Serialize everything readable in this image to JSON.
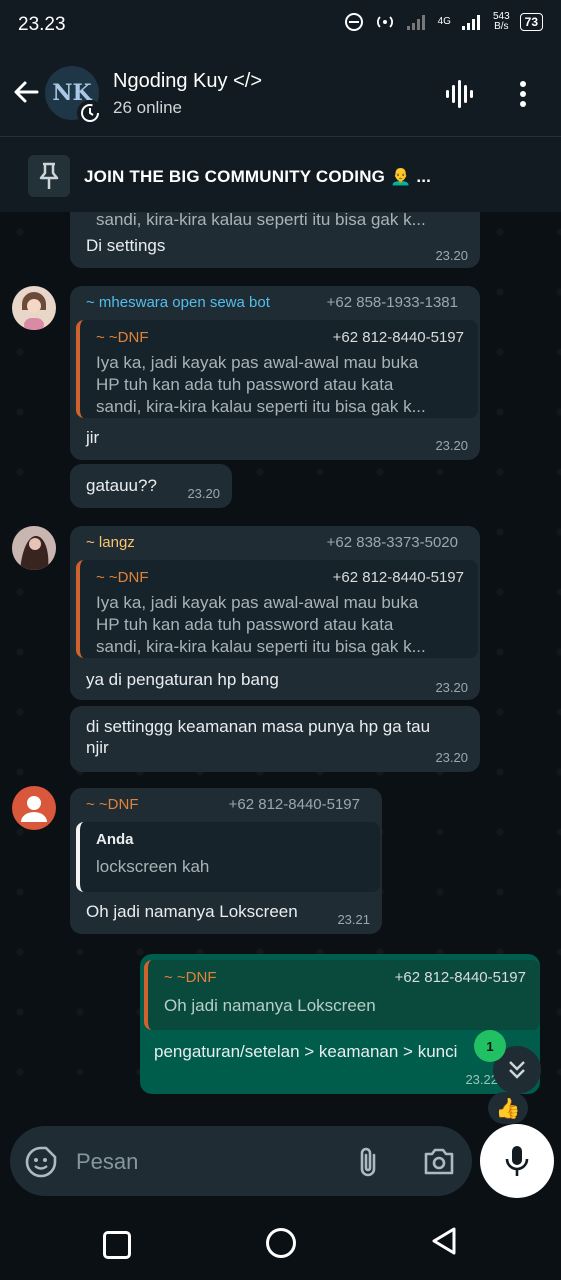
{
  "status_bar": {
    "time": "23.23",
    "network": "4G",
    "speed_value": "543",
    "speed_unit": "B/s",
    "battery": "73"
  },
  "header": {
    "avatar_text": "NK",
    "title": "Ngoding Kuy </>",
    "subtitle": "26 online"
  },
  "pinned": {
    "text": "JOIN THE BIG COMMUNITY CODING 👨‍🦲 ..."
  },
  "colors": {
    "chat_bg": "#0b1014",
    "bubble_in": "#1f2c34",
    "bubble_out": "#005c4b",
    "accent_blue": "#53bdeb",
    "accent_orange": "#e0823a",
    "accent_yellow": "#f7c56b",
    "status_green": "#21c063"
  },
  "messages": [
    {
      "partial_line": "sandi, kira-kira kalau seperti itu bisa gak k...",
      "text": "Di settings",
      "time": "23.20"
    },
    {
      "sender": "~ mheswara open sewa bot",
      "phone": "+62 858-1933-1381",
      "quote": {
        "name": "~ ~DNF",
        "phone": "+62 812-8440-5197",
        "lines": [
          "Iya ka, jadi kayak pas awal-awal mau buka",
          "HP tuh kan ada tuh password atau kata",
          "sandi, kira-kira kalau seperti itu bisa gak k..."
        ]
      },
      "text": "jir",
      "time": "23.20"
    },
    {
      "text": "gatauu??",
      "time": "23.20"
    },
    {
      "sender": "~ langz",
      "phone": "+62 838-3373-5020",
      "quote": {
        "name": "~ ~DNF",
        "phone": "+62 812-8440-5197",
        "lines": [
          "Iya ka, jadi kayak pas awal-awal mau buka",
          "HP tuh kan ada tuh password atau kata",
          "sandi, kira-kira kalau seperti itu bisa gak k..."
        ]
      },
      "text": "ya di pengaturan hp bang",
      "time": "23.20"
    },
    {
      "lines": [
        "di settinggg keamanan masa punya hp ga tau",
        "njir"
      ],
      "time": "23.20"
    },
    {
      "sender": "~ ~DNF",
      "phone": "+62 812-8440-5197",
      "quote": {
        "name": "Anda",
        "line": "lockscreen kah"
      },
      "text": "Oh jadi namanya Lokscreen",
      "time": "23.21"
    },
    {
      "quote": {
        "name": "~ ~DNF",
        "phone": "+62 812-8440-5197",
        "line": "Oh jadi namanya Lokscreen"
      },
      "text": "pengaturan/setelan > keamanan > kunci",
      "time": "23.22",
      "reaction": "👍"
    }
  ],
  "scroll": {
    "unread_count": "1"
  },
  "composer": {
    "placeholder": "Pesan"
  }
}
